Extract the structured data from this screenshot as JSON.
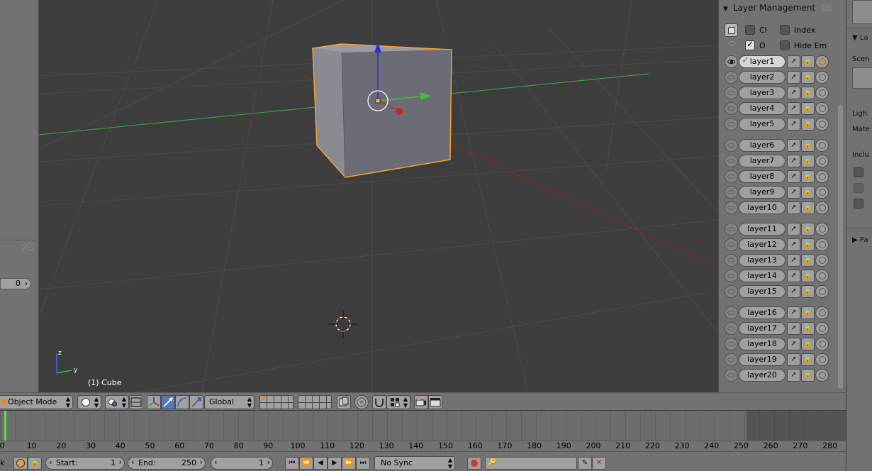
{
  "left_shelf": {
    "counter_value": "0"
  },
  "viewport": {
    "object_label": "(1) Cube",
    "axis_labels": {
      "x": "y",
      "z": "z"
    }
  },
  "layer_panel": {
    "title": "Layer Management",
    "options": {
      "cl_label": "Cl",
      "cl_checked": false,
      "index_label": "Index",
      "index_checked": false,
      "o_label": "O",
      "o_checked": true,
      "hide_em_label": "Hide Em",
      "hide_em_checked": false
    },
    "layers": [
      {
        "name": "layer1",
        "active": true
      },
      {
        "name": "layer2",
        "active": false
      },
      {
        "name": "layer3",
        "active": false
      },
      {
        "name": "layer4",
        "active": false
      },
      {
        "name": "layer5",
        "active": false
      },
      {
        "name": "layer6",
        "active": false
      },
      {
        "name": "layer7",
        "active": false
      },
      {
        "name": "layer8",
        "active": false
      },
      {
        "name": "layer9",
        "active": false
      },
      {
        "name": "layer10",
        "active": false
      },
      {
        "name": "layer11",
        "active": false
      },
      {
        "name": "layer12",
        "active": false
      },
      {
        "name": "layer13",
        "active": false
      },
      {
        "name": "layer14",
        "active": false
      },
      {
        "name": "layer15",
        "active": false
      },
      {
        "name": "layer16",
        "active": false
      },
      {
        "name": "layer17",
        "active": false
      },
      {
        "name": "layer18",
        "active": false
      },
      {
        "name": "layer19",
        "active": false
      },
      {
        "name": "layer20",
        "active": false
      }
    ]
  },
  "properties_strip": {
    "labels": [
      "La",
      "Scen",
      "Ligh",
      "Mate",
      "Inclu",
      "Pa"
    ]
  },
  "view_header": {
    "mode": "Object Mode",
    "orientation": "Global"
  },
  "timeline": {
    "current_frame": 1,
    "ticks": [
      "0",
      "10",
      "20",
      "30",
      "40",
      "50",
      "60",
      "70",
      "80",
      "90",
      "100",
      "110",
      "120",
      "130",
      "140",
      "150",
      "160",
      "170",
      "180",
      "190",
      "200",
      "210",
      "220",
      "230",
      "240",
      "250",
      "260",
      "270",
      "280"
    ],
    "left_edge_label": "k"
  },
  "playback": {
    "start_label": "Start:",
    "start_value": "1",
    "end_label": "End:",
    "end_value": "250",
    "frame_value": "1",
    "sync": "No Sync"
  },
  "colors": {
    "viewport_bg": "#3d3d3d",
    "selection_outline": "#f5a030",
    "x_axis": "#c21f1f",
    "y_axis": "#3bbf3b",
    "z_axis": "#2a2ae0",
    "frame_cursor": "#5ddc45"
  }
}
